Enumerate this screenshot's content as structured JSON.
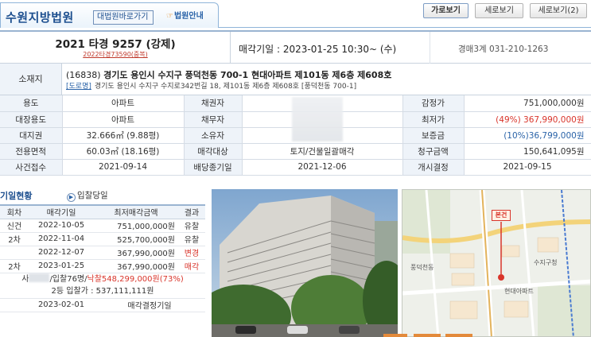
{
  "header": {
    "court_name": "수원지방법원",
    "site_button": "대법원바로가기",
    "guide_icon": "hand-pointer-icon",
    "guide_button": "법원안내",
    "view_buttons": [
      "가로보기",
      "세로보기",
      "세로보기(2)"
    ]
  },
  "case": {
    "number": "2021 타경 9257 (강제)",
    "sub": "2022타경73590(중복)",
    "sale_date": "매각기일 : 2023-01-25 10:30~ (수)",
    "department": "경매3계 031-210-1263"
  },
  "address": {
    "label": "소재지",
    "zip": "(16838)",
    "main": "경기도 용인시 수지구 풍덕천동 700-1 현대아파트 제101동 제6층 제608호",
    "road_tag": "[도로명]",
    "road": "경기도 용인시 수지구 수지로342번길 18, 제101동 제6층 제608호 [풍덕천동 700-1]"
  },
  "grid": {
    "rows": [
      {
        "l1": "용도",
        "v1": "아파트",
        "l2": "채권자",
        "v2": "",
        "l3": "감정가",
        "v3": "751,000,000원"
      },
      {
        "l1": "대장용도",
        "v1": "아파트",
        "l2": "채무자",
        "v2": "",
        "l3": "최저가",
        "v3": "(49%) 367,990,000원"
      },
      {
        "l1": "대지권",
        "v1": "32.666㎡ (9.88평)",
        "l2": "소유자",
        "v2": "",
        "l3": "보증금",
        "v3": "(10%)36,799,000원"
      },
      {
        "l1": "전용면적",
        "v1": "60.03㎡ (18.16평)",
        "l2": "매각대상",
        "v2": "토지/건물일괄매각",
        "l3": "청구금액",
        "v3": "150,641,095원"
      },
      {
        "l1": "사건접수",
        "v1": "2021-09-14",
        "l2": "배당종기일",
        "v2": "2021-12-06",
        "l3": "개시결정",
        "v3": "2021-09-15"
      }
    ]
  },
  "history": {
    "title": "기일현황",
    "link": "입찰당일",
    "columns": [
      "회차",
      "매각기일",
      "최저매각금액",
      "결과"
    ],
    "rows": [
      {
        "round": "신건",
        "date": "2022-10-05",
        "amount": "751,000,000원",
        "result": "유찰"
      },
      {
        "round": "2차",
        "date": "2022-11-04",
        "amount": "525,700,000원",
        "result": "유찰"
      },
      {
        "round": "",
        "date": "2022-12-07",
        "amount": "367,990,000원",
        "result": "변경"
      },
      {
        "round": "2차",
        "date": "2023-01-25",
        "amount": "367,990,000원",
        "result": "매각"
      }
    ],
    "bid_line_a": "/입찰76명/",
    "bid_line_b": "낙찰548,299,000원(73%)",
    "bid_line_c": "2등 입찰가 : 537,111,111원",
    "bid_prefix": "사",
    "final": {
      "date": "2023-02-01",
      "label": "매각결정기일"
    }
  },
  "map": {
    "badge": "본건",
    "labels": [
      "풍덕천동",
      "수지구청",
      "현대아파트"
    ]
  },
  "colors": {
    "accent": "#1d4f8f",
    "red": "#d9352b",
    "blue": "#2a63a8",
    "label_bg": "#eef3f9"
  }
}
